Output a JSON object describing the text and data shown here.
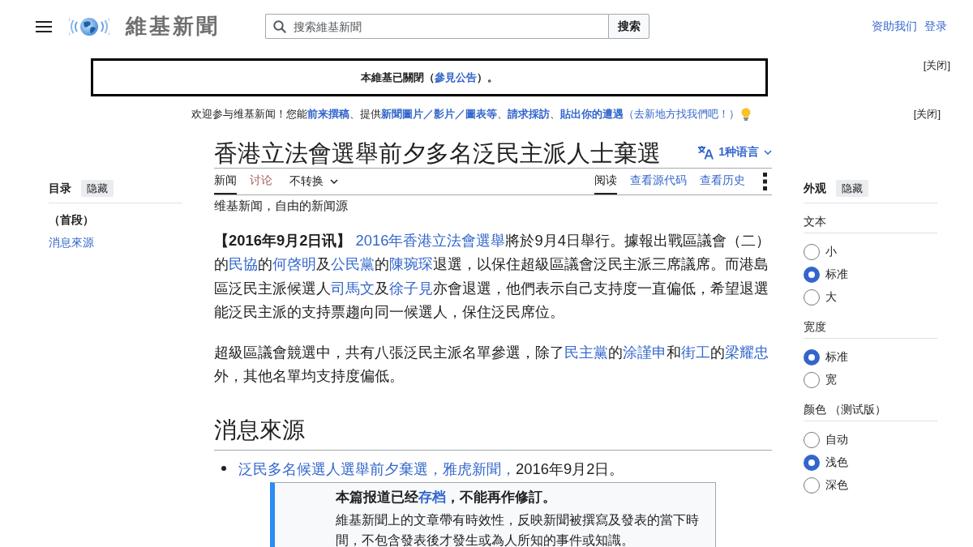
{
  "header": {
    "logo_text": "維基新聞",
    "search": {
      "placeholder": "搜索維基新聞",
      "button": "搜索"
    },
    "user_links": [
      "资助我们",
      "登录"
    ]
  },
  "site_notice": {
    "segments": [
      {
        "kind": "text",
        "text": "本維基已關閉（"
      },
      {
        "kind": "link",
        "text": "參見公告"
      },
      {
        "kind": "text",
        "text": "）。"
      }
    ],
    "close": "[关闭]"
  },
  "welcome_notice": {
    "segments": [
      {
        "kind": "text",
        "text": "欢迎参与维基新闻！您能"
      },
      {
        "kind": "link",
        "text": "前来撰稿",
        "bold": true
      },
      {
        "kind": "text",
        "text": "、提供"
      },
      {
        "kind": "link",
        "text": "新聞圖片／影片／圖表等",
        "bold": true
      },
      {
        "kind": "text",
        "text": "、"
      },
      {
        "kind": "link",
        "text": "請求採訪",
        "bold": true
      },
      {
        "kind": "text",
        "text": "、"
      },
      {
        "kind": "link",
        "text": "貼出你的遭遇",
        "bold": true
      },
      {
        "kind": "link",
        "text": "（去新地方找我們吧！）",
        "bold": false
      }
    ],
    "close": "[关闭]"
  },
  "toc": {
    "title": "目录",
    "toggle": "隐藏",
    "items": [
      {
        "label": "（首段）",
        "selected": true
      },
      {
        "label": "消息來源",
        "selected": false
      }
    ]
  },
  "article": {
    "title": "香港立法會選舉前夕多名泛民主派人士棄選",
    "languages": "1种语言",
    "namespace_tabs": [
      {
        "label": "新闻",
        "selected": true,
        "missing": false
      },
      {
        "label": "讨论",
        "selected": false,
        "missing": true
      }
    ],
    "variant": "不转换",
    "view_tabs": [
      {
        "label": "阅读",
        "selected": true
      },
      {
        "label": "查看源代码",
        "selected": false
      },
      {
        "label": "查看历史",
        "selected": false
      }
    ],
    "tagline": "维基新闻，自由的新闻源",
    "paragraphs": [
      [
        {
          "kind": "text",
          "text": "**【2016年9月2日讯】** "
        },
        {
          "kind": "link",
          "text": "2016年香港立法會選舉"
        },
        {
          "kind": "text",
          "text": "將於9月4日舉行。據報出戰區議會（二）的"
        },
        {
          "kind": "link",
          "text": "民協"
        },
        {
          "kind": "text",
          "text": "的"
        },
        {
          "kind": "link",
          "text": "何啓明"
        },
        {
          "kind": "text",
          "text": "及"
        },
        {
          "kind": "link",
          "text": "公民黨"
        },
        {
          "kind": "text",
          "text": "的"
        },
        {
          "kind": "link",
          "text": "陳琬琛"
        },
        {
          "kind": "text",
          "text": "退選，以保住超級區議會泛民主派三席議席。而港島區泛民主派候選人"
        },
        {
          "kind": "link",
          "text": "司馬文"
        },
        {
          "kind": "text",
          "text": "及"
        },
        {
          "kind": "link",
          "text": "徐子見"
        },
        {
          "kind": "text",
          "text": "亦會退選，他們表示自己支持度一直偏低，希望退選能泛民主派的支持票趨向同一候選人，保住泛民席位。"
        }
      ],
      [
        {
          "kind": "text",
          "text": "超級區議會競選中，共有八張泛民主派名單參選，除了"
        },
        {
          "kind": "link",
          "text": "民主黨"
        },
        {
          "kind": "text",
          "text": "的"
        },
        {
          "kind": "link",
          "text": "涂謹申"
        },
        {
          "kind": "text",
          "text": "和"
        },
        {
          "kind": "link",
          "text": "街工"
        },
        {
          "kind": "text",
          "text": "的"
        },
        {
          "kind": "link",
          "text": "梁耀忠"
        },
        {
          "kind": "text",
          "text": "外，其他名單均支持度偏低。"
        }
      ]
    ],
    "sections": [
      {
        "heading": "消息來源",
        "sources": [
          [
            {
              "kind": "link",
              "text": "泛民多名候選人選舉前夕棄選，"
            },
            {
              "kind": "link",
              "text": "雅虎新聞，"
            },
            {
              "kind": "text",
              "text": "2016年9月2日。"
            }
          ]
        ]
      }
    ],
    "archive_notice": {
      "title": [
        {
          "kind": "text",
          "text": "本篇报道已经"
        },
        {
          "kind": "link",
          "text": "存档"
        },
        {
          "kind": "text",
          "text": "，不能再作修訂。"
        }
      ],
      "text": "維基新聞上的文章帶有時效性，反映新聞被撰寫及發表的當下時間，不包含發表後才發生或為人所知的事件或知識。"
    }
  },
  "appearance": {
    "title": "外观",
    "toggle": "隐藏",
    "groups": [
      {
        "label": "文本",
        "options": [
          {
            "label": "小",
            "selected": false
          },
          {
            "label": "标准",
            "selected": true
          },
          {
            "label": "大",
            "selected": false
          }
        ]
      },
      {
        "label": "宽度",
        "options": [
          {
            "label": "标准",
            "selected": true
          },
          {
            "label": "宽",
            "selected": false
          }
        ]
      },
      {
        "label": "颜色 （测试版）",
        "options": [
          {
            "label": "自动",
            "selected": false
          },
          {
            "label": "浅色",
            "selected": true
          },
          {
            "label": "深色",
            "selected": false
          }
        ]
      }
    ]
  }
}
